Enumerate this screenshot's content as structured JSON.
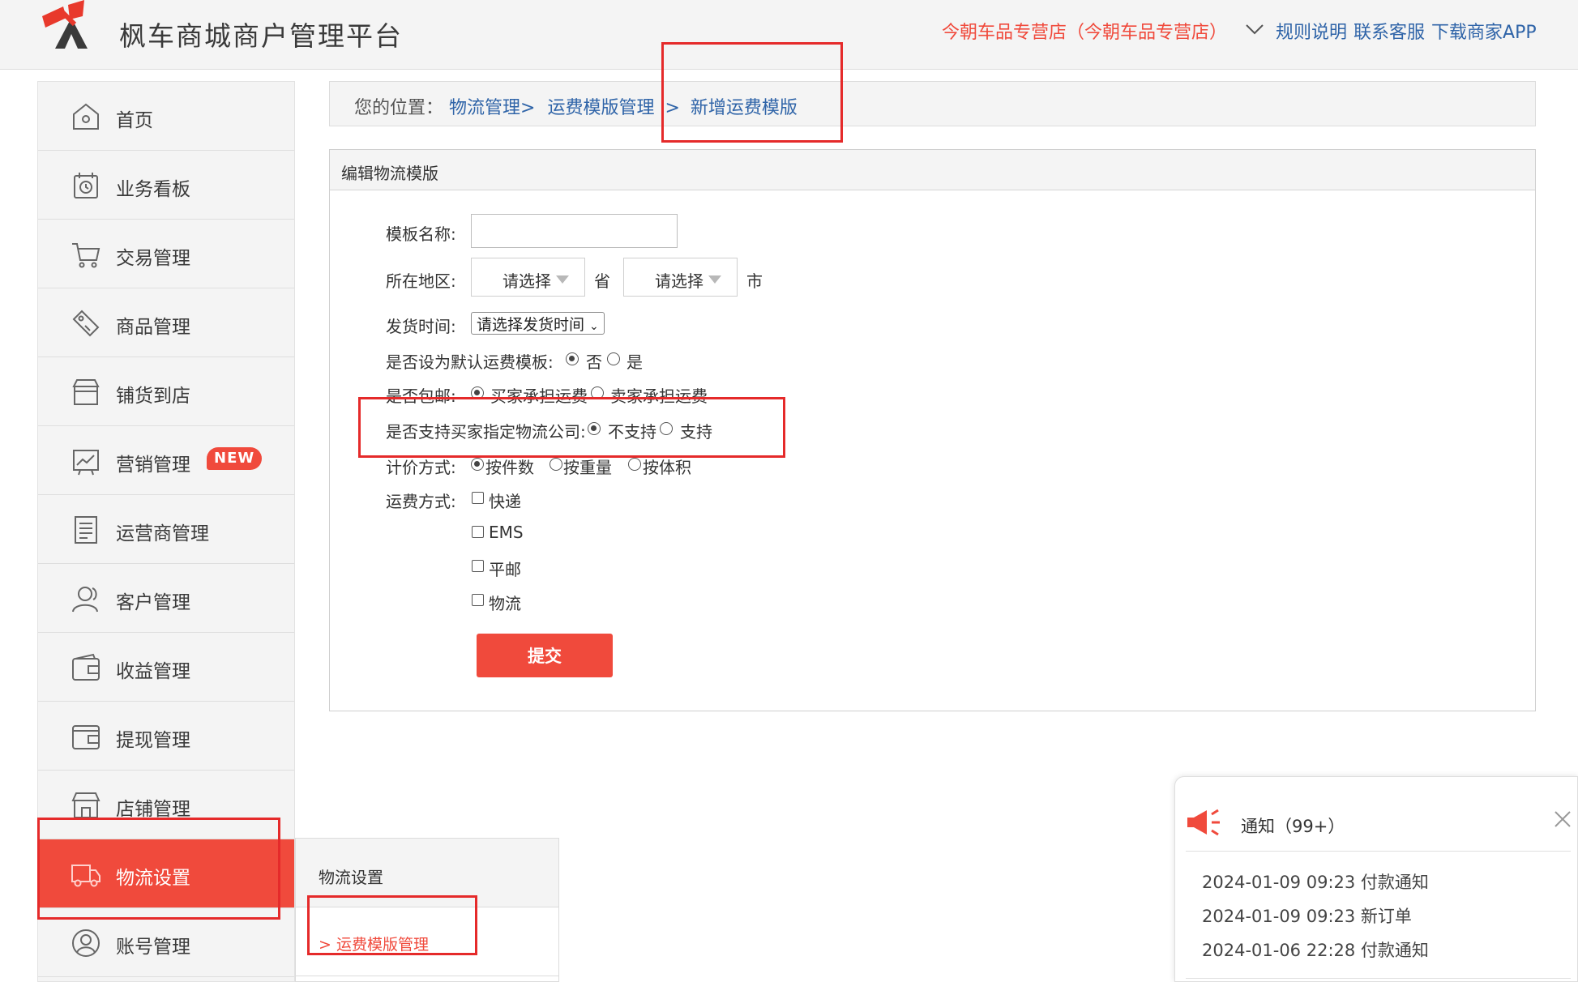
{
  "header": {
    "brand": "枫车商城商户管理平台",
    "store_name": "今朝车品专营店（今朝车品专营店）",
    "links": [
      "规则说明",
      "联系客服",
      "下载商家APP"
    ]
  },
  "sidebar": {
    "items": [
      {
        "label": "首页",
        "icon": "home-icon"
      },
      {
        "label": "业务看板",
        "icon": "dashboard-icon"
      },
      {
        "label": "交易管理",
        "icon": "cart-icon"
      },
      {
        "label": "商品管理",
        "icon": "tag-icon"
      },
      {
        "label": "铺货到店",
        "icon": "store-icon"
      },
      {
        "label": "营销管理",
        "icon": "chart-icon",
        "badge": "NEW"
      },
      {
        "label": "运营商管理",
        "icon": "list-icon"
      },
      {
        "label": "客户管理",
        "icon": "users-icon"
      },
      {
        "label": "收益管理",
        "icon": "wallet-icon"
      },
      {
        "label": "提现管理",
        "icon": "withdraw-icon"
      },
      {
        "label": "店铺管理",
        "icon": "shop-icon"
      },
      {
        "label": "物流设置",
        "icon": "truck-icon",
        "active": true
      },
      {
        "label": "账号管理",
        "icon": "account-icon"
      }
    ],
    "submenu": {
      "title": "物流设置",
      "item": "> 运费模版管理"
    }
  },
  "breadcrumb": {
    "prefix": "您的位置：",
    "crumbs": [
      "物流管理>",
      "运费模版管理",
      ">",
      "新增运费模版"
    ]
  },
  "form": {
    "panel_title": "编辑物流模版",
    "template_name_label": "模板名称:",
    "template_name_value": "",
    "region_label": "所在地区:",
    "province_select": "请选择",
    "province_unit": "省",
    "city_select": "请选择",
    "city_unit": "市",
    "ship_time_label": "发货时间:",
    "ship_time_select": "请选择发货时间",
    "default_label": "是否设为默认运费模板:",
    "default_options": [
      "否",
      "是"
    ],
    "default_selected": "否",
    "free_ship_label": "是否包邮:",
    "free_ship_options": [
      "买家承担运费",
      "卖家承担运费"
    ],
    "free_ship_selected": "买家承担运费",
    "carrier_label": "是否支持买家指定物流公司:",
    "carrier_options": [
      "不支持",
      "支持"
    ],
    "carrier_selected": "不支持",
    "pricing_label": "计价方式:",
    "pricing_options": [
      "按件数",
      "按重量",
      "按体积"
    ],
    "pricing_selected": "按件数",
    "shipping_label": "运费方式:",
    "shipping_options": [
      "快递",
      "EMS",
      "平邮",
      "物流"
    ],
    "submit": "提交"
  },
  "notification": {
    "title": "通知（99+）",
    "items": [
      "2024-01-09 09:23 付款通知",
      "2024-01-09 09:23 新订单",
      "2024-01-06 22:28 付款通知"
    ]
  },
  "colors": {
    "accent": "#f04a3c",
    "link": "#2f64a8",
    "annotation": "#e52a2a"
  }
}
